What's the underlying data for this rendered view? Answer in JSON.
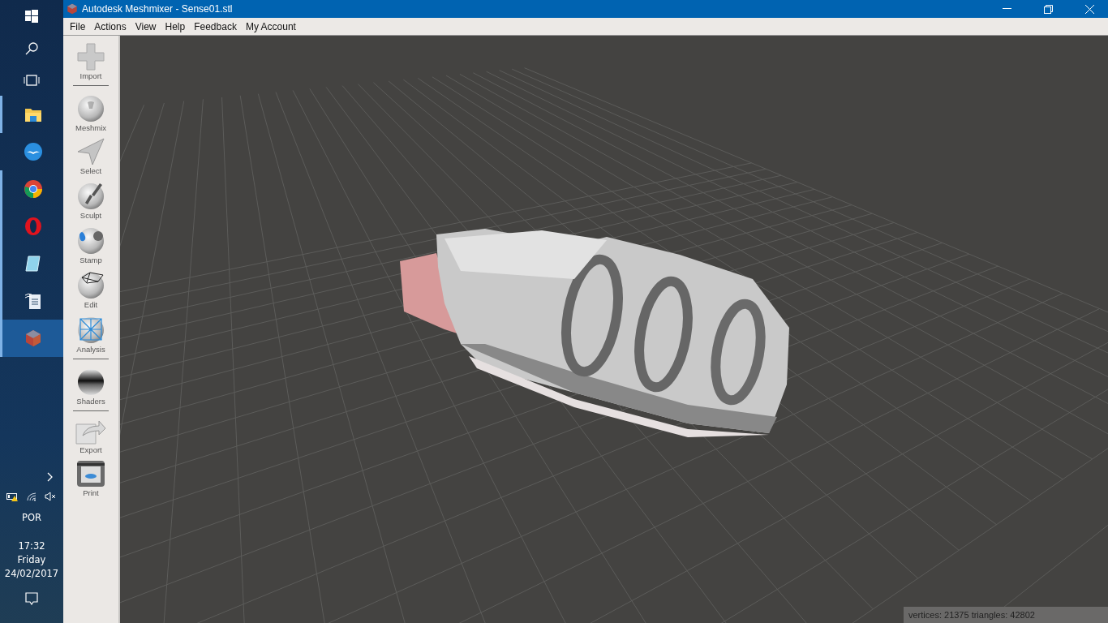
{
  "taskbar": {
    "pinned": [
      {
        "kind": "folder",
        "running": true,
        "selected": false
      },
      {
        "kind": "bird",
        "running": false,
        "selected": false
      },
      {
        "kind": "chrome",
        "running": true,
        "selected": false
      },
      {
        "kind": "opera",
        "running": true,
        "selected": false
      },
      {
        "kind": "notepad",
        "running": true,
        "selected": false
      },
      {
        "kind": "document",
        "running": true,
        "selected": false
      },
      {
        "kind": "gem",
        "running": true,
        "selected": true
      }
    ],
    "tray": {
      "language": "POR",
      "time": "17:32",
      "day": "Friday",
      "date": "24/02/2017"
    }
  },
  "window": {
    "title": "Autodesk Meshmixer - Sense01.stl"
  },
  "menu": [
    "File",
    "Actions",
    "View",
    "Help",
    "Feedback",
    "My Account"
  ],
  "tool_groups": [
    [
      {
        "label": "Import",
        "kind": "plus"
      }
    ],
    [
      {
        "label": "Meshmix",
        "kind": "face"
      },
      {
        "label": "Select",
        "kind": "arrow"
      },
      {
        "label": "Sculpt",
        "kind": "brush"
      },
      {
        "label": "Stamp",
        "kind": "stamp"
      },
      {
        "label": "Edit",
        "kind": "edit"
      },
      {
        "label": "Analysis",
        "kind": "analysis"
      }
    ],
    [
      {
        "label": "Shaders",
        "kind": "chrome-ball"
      }
    ],
    [
      {
        "label": "Export",
        "kind": "export"
      },
      {
        "label": "Print",
        "kind": "printer"
      }
    ]
  ],
  "status": "vertices: 21375 triangles: 42802"
}
